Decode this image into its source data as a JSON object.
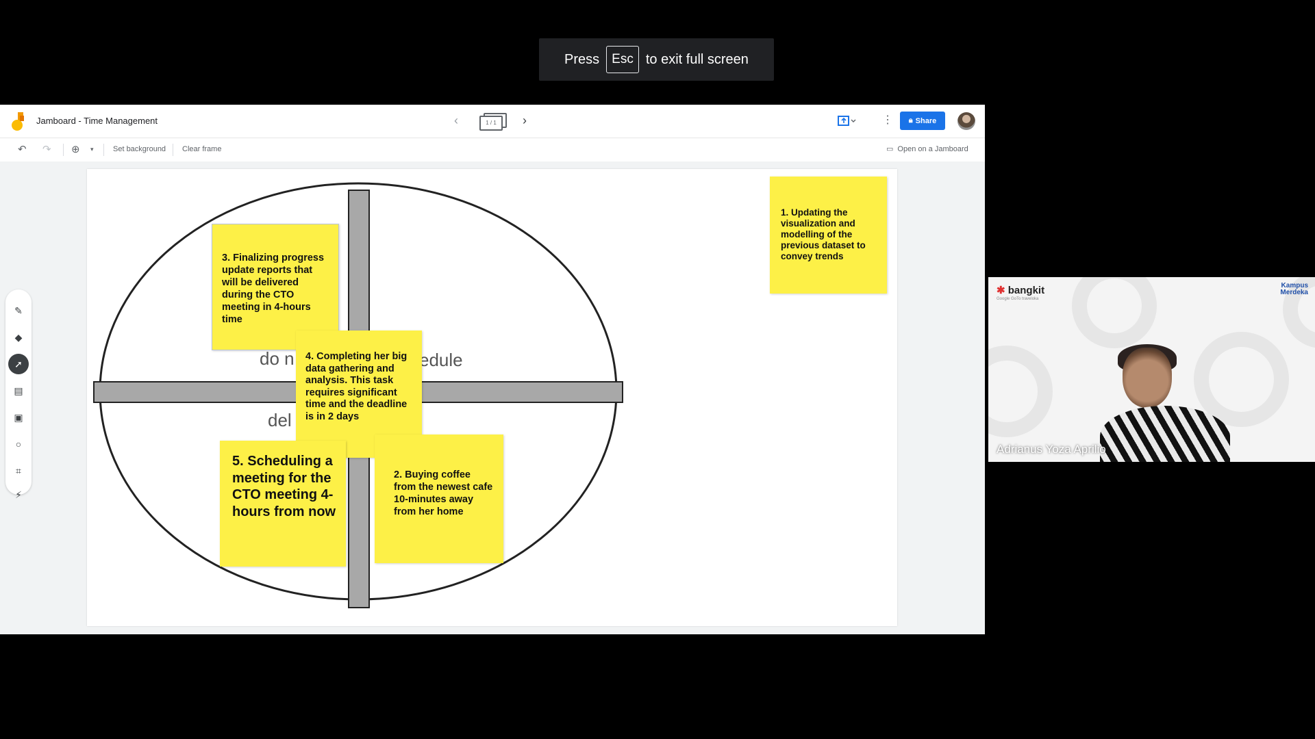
{
  "fullscreen_banner": {
    "press": "Press",
    "key": "Esc",
    "rest": "to exit full screen"
  },
  "jamboard": {
    "title": "Jamboard - Time Management",
    "frame_indicator": "1 / 1",
    "share_label": "Share",
    "toolbar": {
      "set_background": "Set background",
      "clear_frame": "Clear frame",
      "open_on_jamboard": "Open on a Jamboard"
    },
    "tools": [
      "pen-icon",
      "eraser-icon",
      "select-icon",
      "sticky-note-icon",
      "image-icon",
      "circle-icon",
      "text-box-icon",
      "laser-icon"
    ],
    "quadrant_labels": {
      "top_left": "do n",
      "top_right": "edule",
      "bottom_left": "del"
    },
    "notes": {
      "n1": "1. Updating the visualization and modelling of the previous dataset to convey trends",
      "n2": "2. Buying coffee from the newest cafe 10-minutes away from her home",
      "n3": "3. Finalizing progress update reports that will be delivered during the CTO meeting in 4-hours time",
      "n4": "4.  Completing her big data gathering and analysis. This task requires significant time and the deadline is in 2 days",
      "n5": "5. Scheduling a meeting for the CTO meeting 4-hours from now"
    },
    "note_color": "#fdf047"
  },
  "video": {
    "brand": "bangkit",
    "brand_sub": "Google GoTo traveloka",
    "partner": "Kampus Merdeka",
    "participant_name": "Adrianus Yoza Aprilio"
  }
}
